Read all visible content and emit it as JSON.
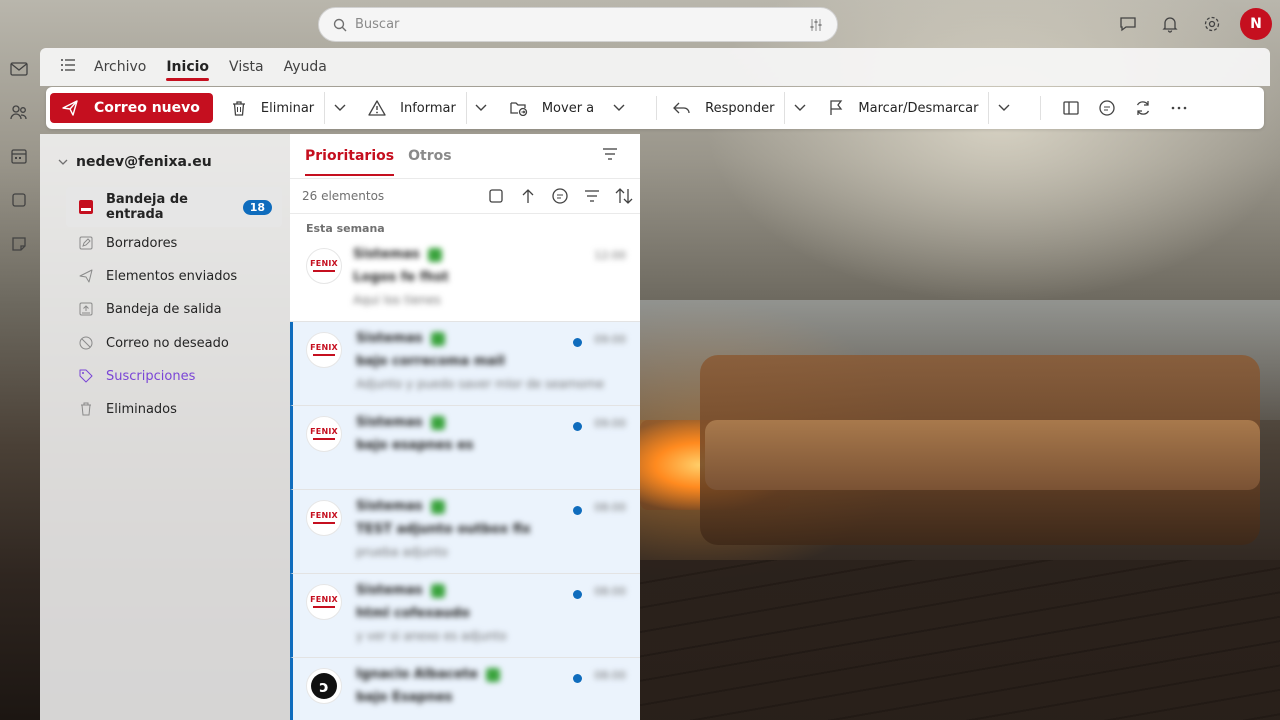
{
  "search": {
    "placeholder": "Buscar"
  },
  "topbar": {
    "avatar_initial": "N"
  },
  "menu": {
    "tabs": [
      {
        "label": "Archivo",
        "active": false
      },
      {
        "label": "Inicio",
        "active": true
      },
      {
        "label": "Vista",
        "active": false
      },
      {
        "label": "Ayuda",
        "active": false
      }
    ]
  },
  "ribbon": {
    "new_mail": "Correo nuevo",
    "delete": "Eliminar",
    "report": "Informar",
    "move": "Mover a",
    "reply": "Responder",
    "flag": "Marcar/Desmarcar"
  },
  "folders": {
    "account": "nedev@fenixa.eu",
    "items": [
      {
        "label": "Bandeja de entrada",
        "badge": "18",
        "icon": "inbox-icon",
        "selected": true
      },
      {
        "label": "Borradores",
        "icon": "pencil-icon"
      },
      {
        "label": "Elementos enviados",
        "icon": "send-icon"
      },
      {
        "label": "Bandeja de salida",
        "icon": "outbox-icon"
      },
      {
        "label": "Correo no deseado",
        "icon": "block-icon"
      },
      {
        "label": "Suscripciones",
        "icon": "tag-icon"
      },
      {
        "label": "Eliminados",
        "icon": "trash-icon"
      }
    ]
  },
  "list": {
    "tab_focused": "Prioritarios",
    "tab_other": "Otros",
    "count": "26 elementos",
    "group_label": "Esta semana",
    "avatar_label": "FENIX",
    "messages": [
      {
        "sender": "Sistemas",
        "subject": "Logos fe fhst",
        "preview": "Aqui los tienes",
        "time": "12:00",
        "unread": false,
        "avatar": "fenix"
      },
      {
        "sender": "Sistemas",
        "subject": "bajo correcoma mail",
        "preview": "Adjunto y puedo saver mlor de seamome",
        "time": "09:00",
        "unread": true,
        "avatar": "fenix"
      },
      {
        "sender": "Sistemas",
        "subject": "bajo esapnes es",
        "preview": "",
        "time": "09:00",
        "unread": true,
        "avatar": "fenix"
      },
      {
        "sender": "Sistemas",
        "subject": "TEST adjunto outbox fix",
        "preview": "prueba adjunto",
        "time": "08:00",
        "unread": true,
        "avatar": "fenix"
      },
      {
        "sender": "Sistemas",
        "subject": "html cofexaudo",
        "preview": "y ver si anexo es adjunto",
        "time": "08:00",
        "unread": true,
        "avatar": "fenix"
      },
      {
        "sender": "Ignacio Albacete",
        "subject": "bajo Esapnes",
        "preview": "",
        "time": "08:00",
        "unread": true,
        "avatar": "dark"
      }
    ]
  },
  "colors": {
    "accent": "#c50f1f",
    "unread_blue": "#0f6cbd",
    "verified_green": "#3aa33d"
  }
}
